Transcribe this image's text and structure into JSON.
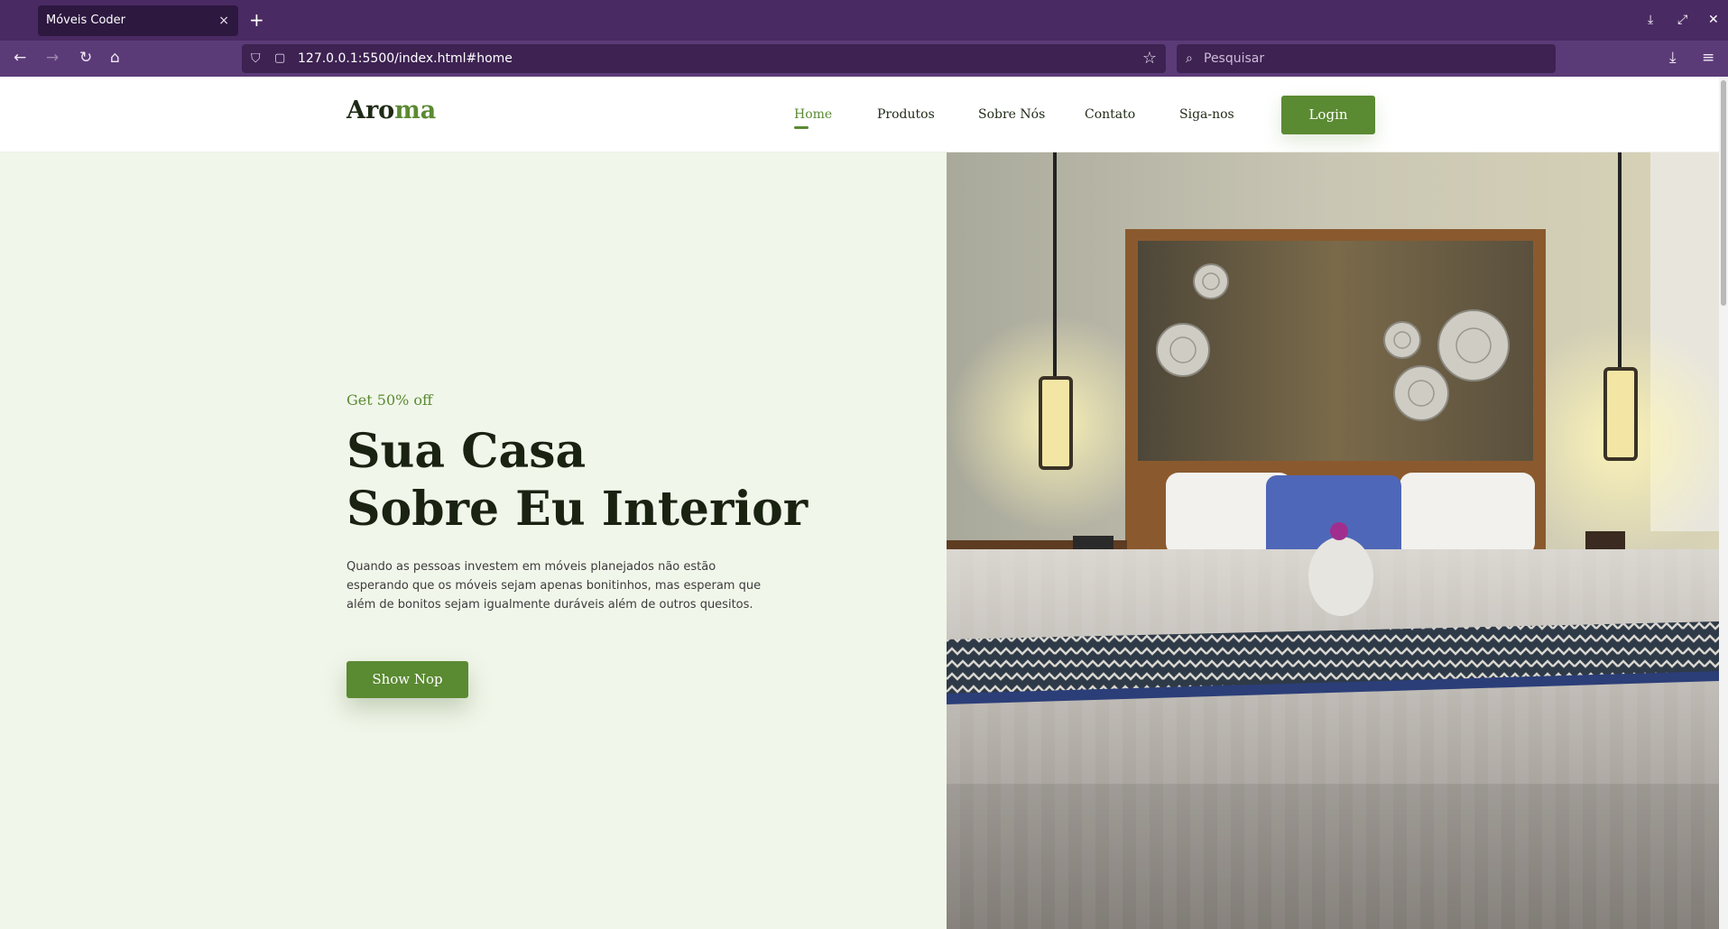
{
  "browser": {
    "tab_title": "Móveis Coder",
    "tab_close": "×",
    "new_tab": "+",
    "url": "127.0.0.1:5500/index.html#home",
    "search_placeholder": "Pesquisar",
    "icons": [
      "back-arrow-icon",
      "forward-arrow-icon",
      "reload-icon",
      "home-icon",
      "shield-icon",
      "page-icon",
      "bookmark-star-icon",
      "search-icon",
      "download-icon",
      "menu-icon"
    ]
  },
  "header": {
    "logo_main": "Aro",
    "logo_accent": "ma",
    "menu": [
      "Home",
      "Produtos",
      "Sobre Nós",
      "Contato",
      "Siga-nos"
    ],
    "active_menu": "Home",
    "login_label": "Login"
  },
  "hero": {
    "tag": "Get 50% off",
    "title_line1": "Sua Casa",
    "title_line2": "Sobre Eu Interior",
    "description": "Quando as pessoas investem em móveis planejados não estão esperando que os móveis sejam apenas bonitinhos, mas esperam que além de bonitos sejam igualmente duráveis além de outros quesitos.",
    "button_label": "Show Nop"
  },
  "colors": {
    "brand_green": "#5a8a32",
    "hero_bg": "#f1f6ea",
    "browser_purple": "#4a2a63"
  }
}
